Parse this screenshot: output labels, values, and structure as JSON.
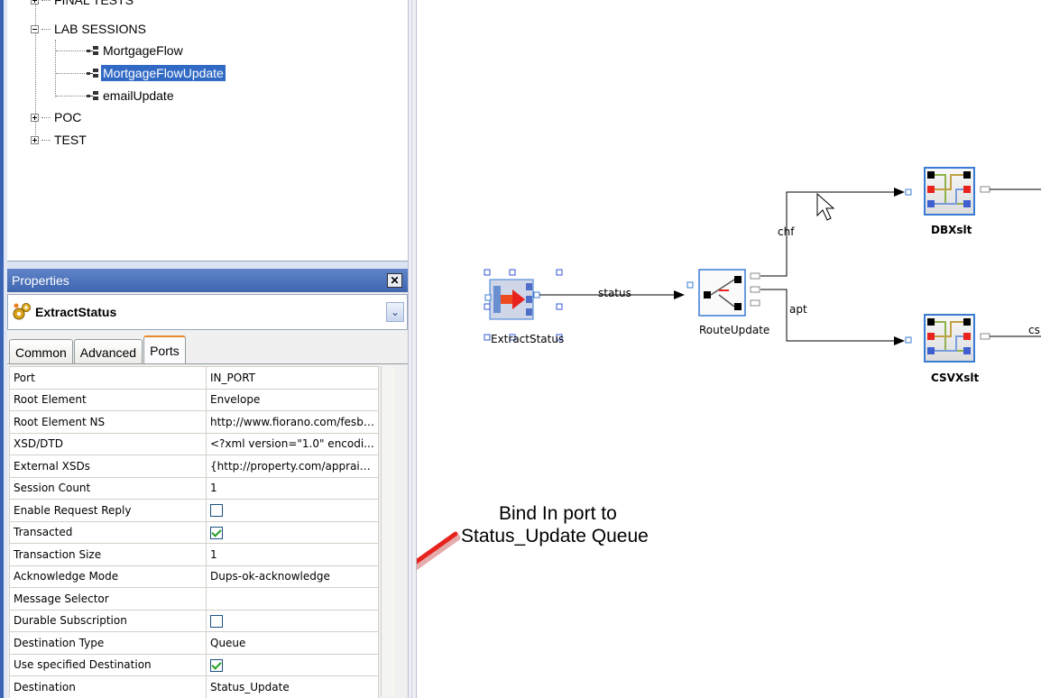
{
  "tree": {
    "items": [
      {
        "label": "FINAL TESTS"
      },
      {
        "label": "LAB SESSIONS"
      },
      {
        "label": "MortgageFlow"
      },
      {
        "label": "MortgageFlowUpdate"
      },
      {
        "label": "emailUpdate"
      },
      {
        "label": "POC"
      },
      {
        "label": "TEST"
      }
    ]
  },
  "properties": {
    "title": "Properties",
    "close_glyph": "✕",
    "component": "ExtractStatus",
    "dropdown_glyph": "⌄",
    "tabs": [
      "Common",
      "Advanced",
      "Ports"
    ],
    "active_tab": "Ports",
    "rows": [
      {
        "key": "Port",
        "value": "IN_PORT"
      },
      {
        "key": "Root Element",
        "value": "Envelope"
      },
      {
        "key": "Root Element NS",
        "value": "http://www.fiorano.com/fesb/..."
      },
      {
        "key": "XSD/DTD",
        "value": "<?xml version=\"1.0\" encodi..."
      },
      {
        "key": "External XSDs",
        "value": "{http://property.com/apprais..."
      },
      {
        "key": "Session Count",
        "value": "1"
      },
      {
        "key": "Enable Request Reply",
        "checked": false
      },
      {
        "key": "Transacted",
        "checked": true
      },
      {
        "key": "Transaction Size",
        "value": "1"
      },
      {
        "key": "Acknowledge Mode",
        "value": "Dups-ok-acknowledge"
      },
      {
        "key": "Message Selector",
        "value": ""
      },
      {
        "key": "Durable Subscription",
        "checked": false
      },
      {
        "key": "Destination Type",
        "value": "Queue"
      },
      {
        "key": "Use specified Destination",
        "checked": true
      },
      {
        "key": "Destination",
        "value": "Status_Update"
      }
    ]
  },
  "canvas": {
    "nodes": {
      "extract": "ExtractStatus",
      "route": "RouteUpdate",
      "dbxslt": "DBXslt",
      "csvxslt": "CSVXslt"
    },
    "edges": {
      "status": "status",
      "chf": "chf",
      "apt": "apt",
      "csv": "cs"
    },
    "annotation": [
      "Bind In port to",
      "Status_Update Queue"
    ],
    "colors": {
      "arrow": "#e8231e",
      "selection": "#2f56d6",
      "node_border": "#3a7bd5"
    }
  }
}
